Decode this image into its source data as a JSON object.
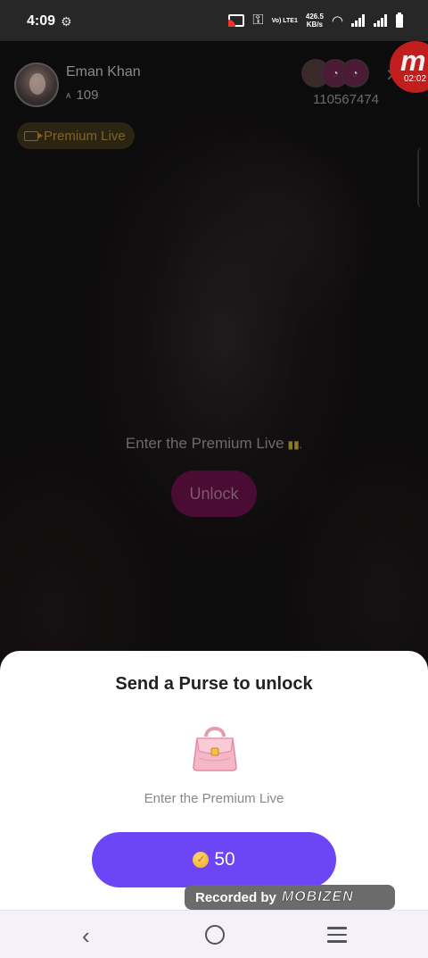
{
  "status_bar": {
    "time": "4:09",
    "network_label": "Vo) LTE1",
    "speed_value": "426.5",
    "speed_unit": "KB/s"
  },
  "host": {
    "name": "Eman Khan",
    "viewer_count": "109",
    "badge_label": "Premium Live"
  },
  "room": {
    "id": "110567474"
  },
  "recorder": {
    "elapsed": "02:02",
    "watermark_prefix": "Recorded by",
    "watermark_brand": "MOBIZEN"
  },
  "locked_overlay": {
    "message": "Enter the Premium Live",
    "unlock_label": "Unlock"
  },
  "sheet": {
    "title": "Send a Purse to unlock",
    "subtitle": "Enter the Premium Live",
    "price": "50",
    "gift_icon": "purse-icon"
  },
  "colors": {
    "accent": "#6c45f6",
    "premium_badge_text": "#7d6525",
    "unlock_button": "#4a0c33"
  }
}
